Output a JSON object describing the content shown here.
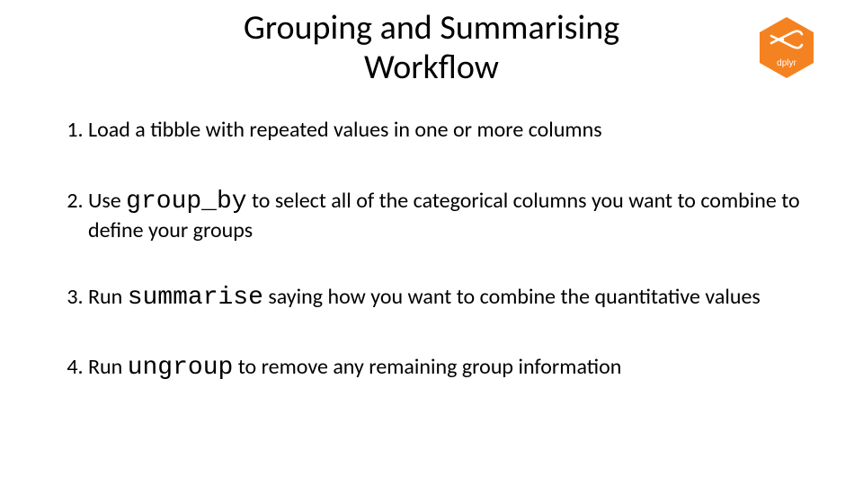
{
  "title_line1": "Grouping and Summarising",
  "title_line2": "Workflow",
  "logo_label": "dplyr",
  "items": [
    {
      "num": "1.",
      "pre": "Load a tibble with repeated values in one or more columns",
      "code": "",
      "post": ""
    },
    {
      "num": "2.",
      "pre": "Use ",
      "code": "group_by",
      "post": " to select all of the categorical columns you want to combine to define your groups"
    },
    {
      "num": "3.",
      "pre": "Run ",
      "code": "summarise",
      "post": " saying how you want to combine the quantitative values"
    },
    {
      "num": "4.",
      "pre": "Run ",
      "code": "ungroup",
      "post": " to remove any remaining group information"
    }
  ]
}
